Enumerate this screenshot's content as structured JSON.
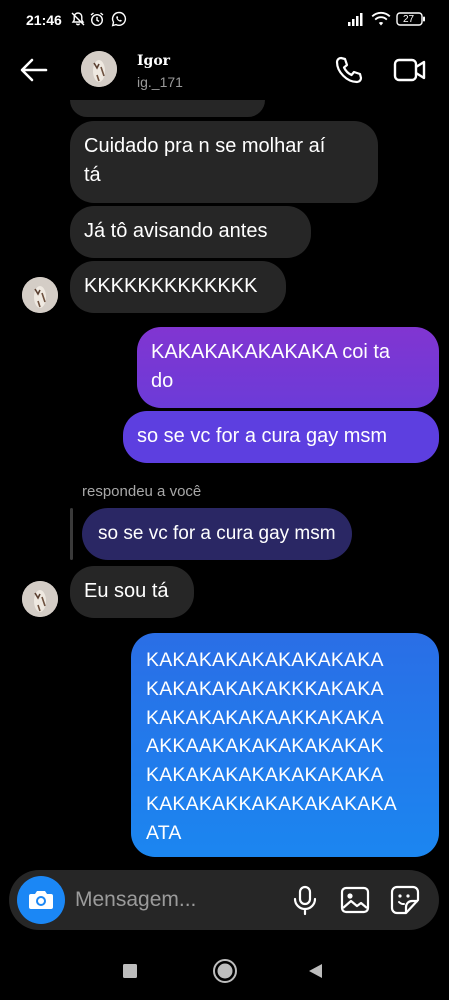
{
  "status_bar": {
    "time": "21:46",
    "battery": "27",
    "icons": [
      "notifications-muted-icon",
      "alarm-icon",
      "whatsapp-icon",
      "signal-icon",
      "wifi-icon",
      "battery-icon"
    ]
  },
  "header": {
    "back_icon": "arrow-left-icon",
    "contact_name": "Igor",
    "contact_handle": "ig._171",
    "call_icon": "phone-icon",
    "video_icon": "video-camera-icon"
  },
  "messages": {
    "m1": "Cuidado pra n se molhar aí\ntá",
    "m2": "Já tô avisando antes",
    "m3": "KKKKKKKKKKKKK",
    "m4": "KAKAKAKAKAKAKA coi ta\ndo",
    "m5": "so se vc for a cura gay msm",
    "reply_label": "respondeu a você",
    "reply_quote": "so se vc for a cura gay msm",
    "m6": "Eu sou tá",
    "m7": "KAKAKAKAKAKAKAKAKA\nKAKAKAKAKAKKKAKAKA\nKAKAKAKAKAAKKAKAKA\nAKKAAKAKAKAKAKAKAK\nKAKAKAKAKAKAKAKAKA\nKAKAKAKKAKAKAKAKAKA\nATA"
  },
  "colors": {
    "received_bubble": "#262626",
    "sent_purple": "#7b2fd0",
    "sent_violet": "#5d3fe0",
    "sent_blue": "#1f7ae8",
    "reply_quote_bg": "#2a2764"
  },
  "composer": {
    "placeholder": "Mensagem...",
    "camera_icon": "camera-icon",
    "mic_icon": "microphone-icon",
    "gallery_icon": "image-gallery-icon",
    "sticker_icon": "sticker-icon"
  },
  "nav_bar": {
    "icons": [
      "recents-square-icon",
      "home-circle-icon",
      "back-triangle-icon"
    ]
  }
}
